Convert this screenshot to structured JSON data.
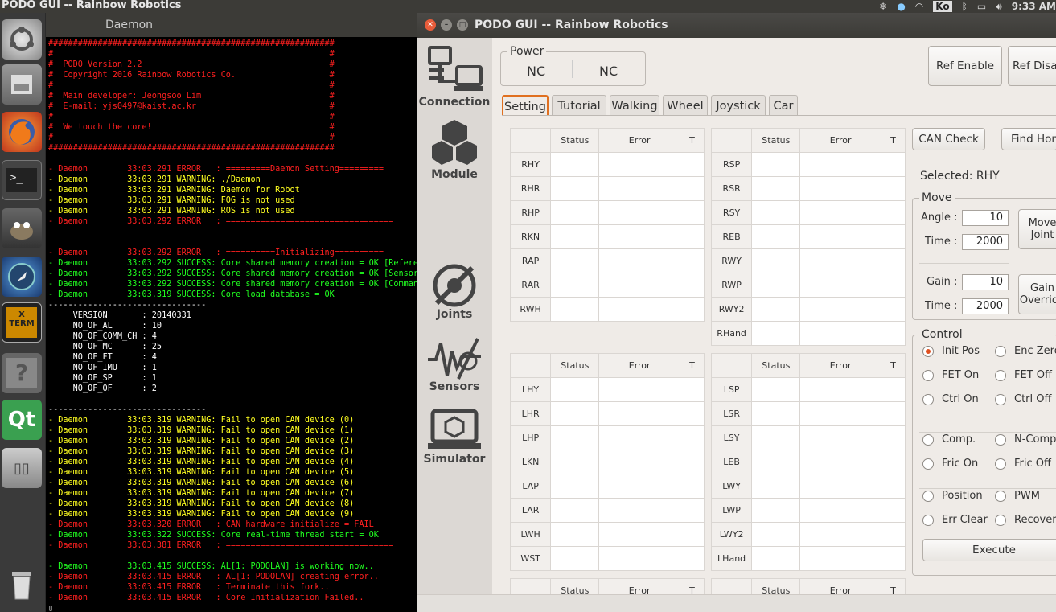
{
  "topbar": {
    "title": "PODO GUI -- Rainbow Robotics",
    "keyboard": "Ko",
    "clock": "9:33 AM"
  },
  "terminal": {
    "title": "Daemon",
    "lines": [
      {
        "t": "##########################################################",
        "c": "#ff2020"
      },
      {
        "t": "#                                                        #",
        "c": "#ff2020"
      },
      {
        "t": "#  PODO Version 2.2                                      #",
        "c": "#ff2020"
      },
      {
        "t": "#  Copyright 2016 Rainbow Robotics Co.                   #",
        "c": "#ff2020"
      },
      {
        "t": "#                                                        #",
        "c": "#ff2020"
      },
      {
        "t": "#  Main developer: Jeongsoo Lim                          #",
        "c": "#ff2020"
      },
      {
        "t": "#  E-mail: yjs0497@kaist.ac.kr                           #",
        "c": "#ff2020"
      },
      {
        "t": "#                                                        #",
        "c": "#ff2020"
      },
      {
        "t": "#  We touch the core!                                    #",
        "c": "#ff2020"
      },
      {
        "t": "#                                                        #",
        "c": "#ff2020"
      },
      {
        "t": "##########################################################",
        "c": "#ff2020"
      },
      {
        "t": "",
        "c": "#ff2020"
      },
      {
        "t": "- Daemon        33:03.291 ERROR   : =========Daemon Setting=========",
        "c": "#ff2020"
      },
      {
        "t": "- Daemon        33:03.291 WARNING: ./Daemon",
        "c": "#ffff20"
      },
      {
        "t": "- Daemon        33:03.291 WARNING: Daemon for Robot",
        "c": "#ffff20"
      },
      {
        "t": "- Daemon        33:03.291 WARNING: FOG is not used",
        "c": "#ffff20"
      },
      {
        "t": "- Daemon        33:03.291 WARNING: ROS is not used",
        "c": "#ffff20"
      },
      {
        "t": "- Daemon        33:03.292 ERROR   : ==================================",
        "c": "#ff2020"
      },
      {
        "t": "",
        "c": "#ff2020"
      },
      {
        "t": "",
        "c": "#ff2020"
      },
      {
        "t": "- Daemon        33:03.292 ERROR   : ==========Initializing==========",
        "c": "#ff2020"
      },
      {
        "t": "- Daemon        33:03.292 SUCCESS: Core shared memory creation = OK [Reference]",
        "c": "#20ff20"
      },
      {
        "t": "- Daemon        33:03.292 SUCCESS: Core shared memory creation = OK [Sensor]",
        "c": "#20ff20"
      },
      {
        "t": "- Daemon        33:03.292 SUCCESS: Core shared memory creation = OK [Command]",
        "c": "#20ff20"
      },
      {
        "t": "- Daemon        33:03.319 SUCCESS: Core load database = OK",
        "c": "#20ff20"
      },
      {
        "t": "--------------------------------",
        "c": "#ffffff"
      },
      {
        "t": "     VERSION       : 20140331",
        "c": "#ffffff"
      },
      {
        "t": "     NO_OF_AL      : 10",
        "c": "#ffffff"
      },
      {
        "t": "     NO_OF_COMM_CH : 4",
        "c": "#ffffff"
      },
      {
        "t": "     NO_OF_MC      : 25",
        "c": "#ffffff"
      },
      {
        "t": "     NO_OF_FT      : 4",
        "c": "#ffffff"
      },
      {
        "t": "     NO_OF_IMU     : 1",
        "c": "#ffffff"
      },
      {
        "t": "     NO_OF_SP      : 1",
        "c": "#ffffff"
      },
      {
        "t": "     NO_OF_OF      : 2",
        "c": "#ffffff"
      },
      {
        "t": "",
        "c": "#ffffff"
      },
      {
        "t": "--------------------------------",
        "c": "#ffffff"
      },
      {
        "t": "- Daemon        33:03.319 WARNING: Fail to open CAN device (0)",
        "c": "#ffff20"
      },
      {
        "t": "- Daemon        33:03.319 WARNING: Fail to open CAN device (1)",
        "c": "#ffff20"
      },
      {
        "t": "- Daemon        33:03.319 WARNING: Fail to open CAN device (2)",
        "c": "#ffff20"
      },
      {
        "t": "- Daemon        33:03.319 WARNING: Fail to open CAN device (3)",
        "c": "#ffff20"
      },
      {
        "t": "- Daemon        33:03.319 WARNING: Fail to open CAN device (4)",
        "c": "#ffff20"
      },
      {
        "t": "- Daemon        33:03.319 WARNING: Fail to open CAN device (5)",
        "c": "#ffff20"
      },
      {
        "t": "- Daemon        33:03.319 WARNING: Fail to open CAN device (6)",
        "c": "#ffff20"
      },
      {
        "t": "- Daemon        33:03.319 WARNING: Fail to open CAN device (7)",
        "c": "#ffff20"
      },
      {
        "t": "- Daemon        33:03.319 WARNING: Fail to open CAN device (8)",
        "c": "#ffff20"
      },
      {
        "t": "- Daemon        33:03.319 WARNING: Fail to open CAN device (9)",
        "c": "#ffff20"
      },
      {
        "t": "- Daemon        33:03.320 ERROR   : CAN hardware initialize = FAIL",
        "c": "#ff2020"
      },
      {
        "t": "- Daemon        33:03.322 SUCCESS: Core real-time thread start = OK",
        "c": "#20ff20"
      },
      {
        "t": "- Daemon        33:03.381 ERROR   : ==================================",
        "c": "#ff2020"
      },
      {
        "t": "",
        "c": "#ff2020"
      },
      {
        "t": "- Daemon        33:03.415 SUCCESS: AL[1: PODOLAN] is working now..",
        "c": "#20ff20"
      },
      {
        "t": "- Daemon        33:03.415 ERROR   : AL[1: PODOLAN] creating error..",
        "c": "#ff2020"
      },
      {
        "t": "- Daemon        33:03.415 ERROR   : Terminate this fork..",
        "c": "#ff2020"
      },
      {
        "t": "- Daemon        33:03.415 ERROR   : Core Initialization Failed..",
        "c": "#ff2020"
      }
    ],
    "cursor": "▯"
  },
  "gui": {
    "title": "PODO GUI -- Rainbow Robotics",
    "nav": {
      "connection": "Connection",
      "module": "Module",
      "joints": "Joints",
      "sensors": "Sensors",
      "simulator": "Simulator"
    },
    "power": {
      "title": "Power",
      "val1": "NC",
      "val2": "NC"
    },
    "ref_enable": "Ref Enable",
    "ref_disable": "Ref Disable",
    "tabs": [
      "Setting",
      "Tutorial",
      "Walking",
      "Wheel",
      "Joystick",
      "Car"
    ],
    "col": {
      "status": "Status",
      "error": "Error",
      "t": "T"
    },
    "tables": {
      "t1": [
        "RHY",
        "RHR",
        "RHP",
        "RKN",
        "RAP",
        "RAR",
        "RWH"
      ],
      "t2": [
        "RSP",
        "RSR",
        "RSY",
        "REB",
        "RWY",
        "RWP",
        "RWY2",
        "RHand"
      ],
      "t3": [
        "LHY",
        "LHR",
        "LHP",
        "LKN",
        "LAP",
        "LAR",
        "LWH",
        "WST"
      ],
      "t4": [
        "LSP",
        "LSR",
        "LSY",
        "LEB",
        "LWY",
        "LWP",
        "LWY2",
        "LHand"
      ]
    },
    "can_check": "CAN Check",
    "find_home": "Find Home",
    "selected": "Selected: RHY",
    "move": {
      "title": "Move",
      "angle_label": "Angle :",
      "angle": "10",
      "time_label": "Time :",
      "time1": "2000",
      "move_joint": "Move Joint",
      "gain_label": "Gain :",
      "gain": "10",
      "time2": "2000",
      "gain_override": "Gain Override"
    },
    "control": {
      "title": "Control",
      "radios": [
        "Init Pos",
        "Enc Zero",
        "FET On",
        "FET Off",
        "Ctrl On",
        "Ctrl Off",
        "Comp.",
        "N-Comp.",
        "Fric On",
        "Fric Off",
        "Position",
        "PWM",
        "Err Clear",
        "Recover"
      ],
      "execute": "Execute"
    }
  }
}
